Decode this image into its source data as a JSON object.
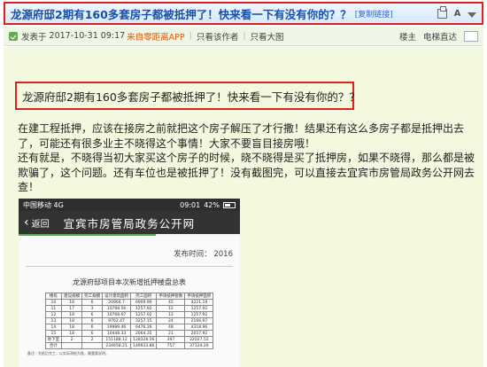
{
  "thread": {
    "title": "龙源府邸2期有160多套房子都被抵押了！快来看一下有没有你的？？",
    "copy_link": "[复制链接]"
  },
  "meta": {
    "posted_label": "发表于",
    "posted_time": "2017-10-31 09:17",
    "source": "来自零距离APP",
    "author_only": "只看该作者",
    "large_image": "只看大图",
    "floor_label": "楼主",
    "elevator_label": "电梯直达"
  },
  "post": {
    "heading": "龙源府邸2期有160多套房子都被抵押了！快来看一下有没有你的？？",
    "paragraph1": "在建工程抵押，应该在接房之前就把这个房子解压了才行撒！结果还有这么多房子都是抵押出去了，可能还有很多业主不晓得这个事情！大家不要盲目接房哦！",
    "paragraph2": "还有就是，不晓得当初大家买这个房子的时候，晓不晓得是买了抵押房，如果不晓得，那么都是被欺骗了，这个问题。还有车位也是被抵押了！没有截图完，可以直接去宜宾市房管局政务公开网去查！"
  },
  "phone": {
    "carrier": "中国移动",
    "network": "4G",
    "time": "09:01",
    "battery": "42%",
    "back_label": "返回",
    "nav_title": "宜宾市房管局政务公开网",
    "publish_time": "发布时间：  2016",
    "doc_title": "龙源府邸项目本次新增抵押楼盘总表",
    "table_headers": [
      "楼栋",
      "建设规模",
      "完工规模",
      "设计建筑面积",
      "完工面积",
      "申请抵押套数",
      "申请抵押面积"
    ],
    "table_rows": [
      [
        "10",
        "18",
        "6",
        "20964.7",
        "6909.90",
        "45",
        "4221.19"
      ],
      [
        "11",
        "17",
        "3",
        "10768.56",
        "1257.92",
        "12",
        "1257.92"
      ],
      [
        "12",
        "18",
        "6",
        "10768.67",
        "1257.92",
        "12",
        "1257.92"
      ],
      [
        "13",
        "18",
        "6",
        "9762.47",
        "3257.15",
        "24",
        "2166.97"
      ],
      [
        "14",
        "18",
        "6",
        "19989.46",
        "6476.26",
        "48",
        "4318.96"
      ],
      [
        "15",
        "18",
        "6",
        "10448.33",
        "2064.35",
        "21",
        "2057.92"
      ],
      [
        "地下室",
        "2",
        "2",
        "151188.12",
        "128328.56",
        "397",
        "22027.52"
      ],
      [
        "合计",
        "",
        "",
        "234658.21",
        "149933.86",
        "757",
        "37324.26"
      ]
    ],
    "note": "备注：先抵后完工，以实际测绘为准，最重要说明。"
  }
}
